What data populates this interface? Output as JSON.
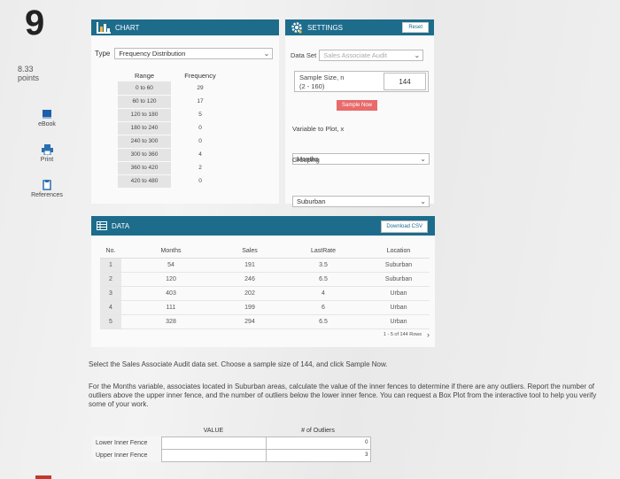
{
  "question_number": "9",
  "points": {
    "value": "8.33",
    "label": "points"
  },
  "sidebar": [
    {
      "label": "eBook",
      "icon": "ebook-icon"
    },
    {
      "label": "Print",
      "icon": "print-icon"
    },
    {
      "label": "References",
      "icon": "references-icon"
    }
  ],
  "chart": {
    "title": "CHART",
    "type_label": "Type",
    "type_value": "Frequency Distribution",
    "col_range": "Range",
    "col_freq": "Frequency",
    "rows": [
      {
        "range": "0 to 60",
        "freq": "29"
      },
      {
        "range": "60 to 120",
        "freq": "17"
      },
      {
        "range": "120 to 180",
        "freq": "5"
      },
      {
        "range": "180 to 240",
        "freq": "0"
      },
      {
        "range": "240 to 300",
        "freq": "0"
      },
      {
        "range": "300 to 360",
        "freq": "4"
      },
      {
        "range": "360 to 420",
        "freq": "2"
      },
      {
        "range": "420 to 480",
        "freq": "0"
      }
    ]
  },
  "settings": {
    "title": "SETTINGS",
    "reset_label": "Reset",
    "dataset_label": "Data Set",
    "dataset_value": "Sales Associate Audit",
    "sample_label": "Sample Size, n",
    "sample_range": "(2 - 160)",
    "sample_value": "144",
    "sample_button": "Sample Now",
    "variable_label": "Variable to Plot, x",
    "variable_value": "Months",
    "grouping_label": "Grouping",
    "grouping_value": "Suburban"
  },
  "data": {
    "title": "DATA",
    "download_label": "Download CSV",
    "columns": [
      "No.",
      "Months",
      "Sales",
      "LastRate",
      "Location"
    ],
    "rows": [
      [
        "1",
        "54",
        "191",
        "3.5",
        "Suburban"
      ],
      [
        "2",
        "120",
        "246",
        "6.5",
        "Suburban"
      ],
      [
        "3",
        "403",
        "202",
        "4",
        "Urban"
      ],
      [
        "4",
        "111",
        "199",
        "6",
        "Urban"
      ],
      [
        "5",
        "328",
        "294",
        "6.5",
        "Urban"
      ]
    ],
    "pagination": "1 - 5 of 144 Rows"
  },
  "instructions": {
    "line1": "Select the Sales Associate Audit data set. Choose a sample size of 144, and click Sample Now.",
    "line2": "For the Months variable, associates located in Suburban areas, calculate the value of the inner fences to determine if there are any outliers. Report the number of outliers above the upper inner fence, and the number of outliers below the lower inner fence. You can request a Box Plot from the interactive tool to help you verify some of your work."
  },
  "fences": {
    "col_value": "VALUE",
    "col_outliers": "# of Outliers",
    "rows": [
      {
        "label": "Lower Inner Fence",
        "value": "",
        "outliers": "0"
      },
      {
        "label": "Upper Inner Fence",
        "value": "",
        "outliers": "3"
      }
    ]
  },
  "colors": {
    "header": "#1d6c8c",
    "sample_button": "#e96a6a"
  }
}
